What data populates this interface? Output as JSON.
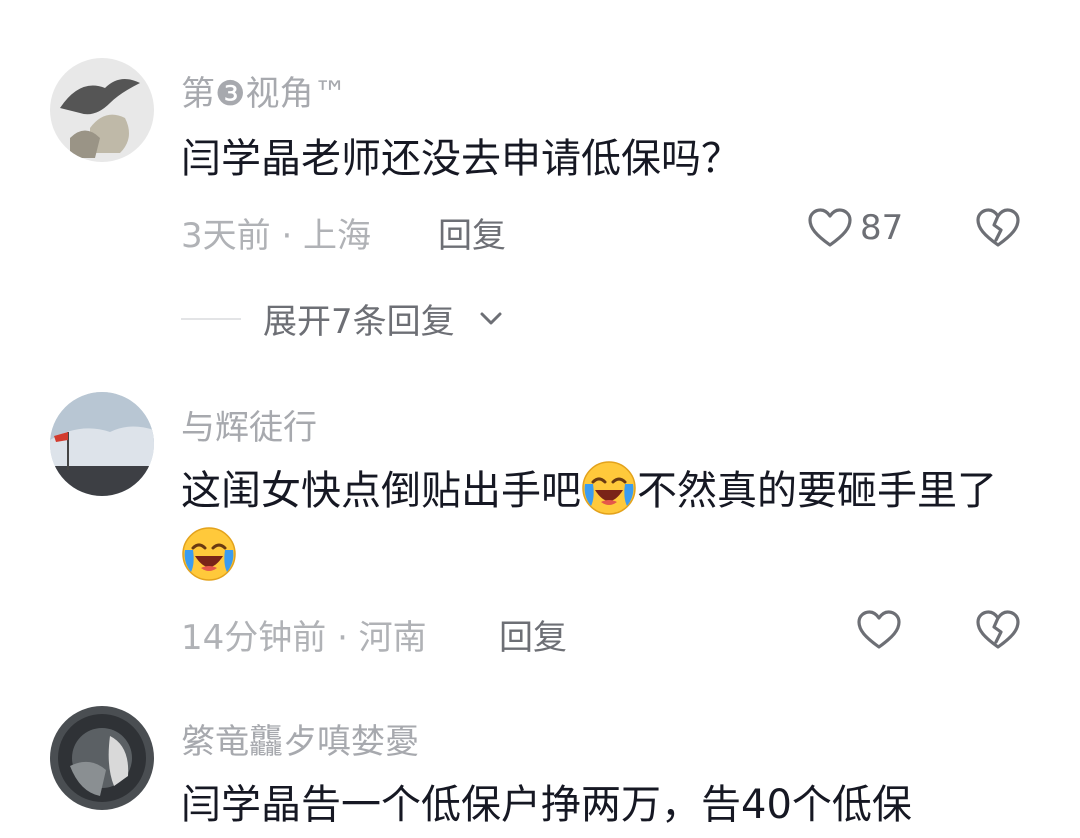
{
  "comments": [
    {
      "username": "第❸视角™",
      "text": "闫学晶老师还没去申请低保吗？",
      "meta": "3天前 · 上海",
      "reply_label": "回复",
      "like_count": "87",
      "expand_label": "展开7条回复"
    },
    {
      "username": "与辉徒行",
      "text_part1": "这闺女快点倒贴出手吧",
      "text_part2": "不然真的要砸手里了",
      "meta": "14分钟前 · 河南",
      "reply_label": "回复"
    },
    {
      "username": "綮竜龘歺嗔婪憂",
      "text": "闫学晶告一个低保户挣两万，告40个低保"
    }
  ],
  "icons": {
    "like": "heart-outline-icon",
    "dislike": "broken-heart-icon",
    "expand": "chevron-down-icon",
    "emoji": "laughing-crying-emoji"
  },
  "colors": {
    "username": "#a7a9ae",
    "text": "#161823",
    "meta": "#b0b2b6",
    "action": "#6d6f75"
  }
}
